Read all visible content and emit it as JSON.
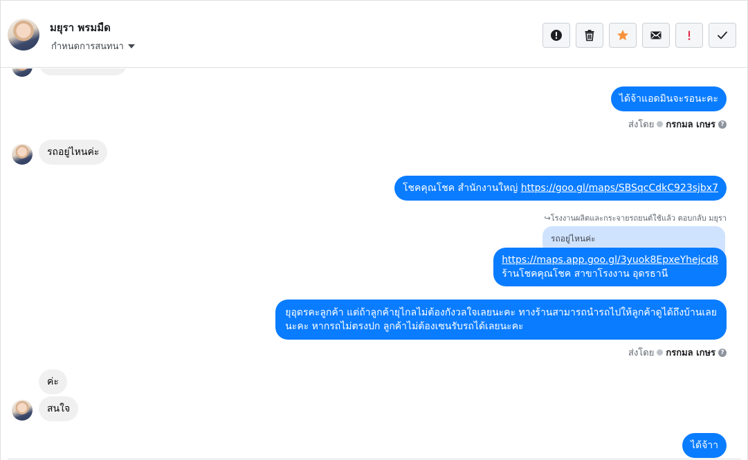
{
  "contact": {
    "name": "มยุรา พรมมืด",
    "assign_label": "กำหนดการสนทนา"
  },
  "toolbar": {
    "buttons": [
      {
        "icon": "spam-icon",
        "color": "#1c1e21"
      },
      {
        "icon": "trash-icon",
        "color": "#1c1e21"
      },
      {
        "icon": "star-icon",
        "color": "#f7923a"
      },
      {
        "icon": "mail-icon",
        "color": "#1c1e21"
      },
      {
        "icon": "important-icon",
        "color": "#e41e3f"
      },
      {
        "icon": "check-icon",
        "color": "#1c1e21"
      }
    ]
  },
  "messages": {
    "m1": "ได้จ้าแอดมินจะรอนะคะ",
    "m2": "รถอยู่ไหนค่ะ",
    "m3_text": "โชคคุณโชค สำนักงานใหญ่ ",
    "m3_link": "https://goo.gl/maps/SBSqcCdkC923sjbx7",
    "reply_hint": "โรงงานผลิตและกระจายรถยนต์ใช้แล้ว ตอบกลับ มยุรา",
    "reply_quote": "รถอยู่ไหนค่ะ",
    "m4_link": "https://maps.app.goo.gl/3yuok8EpxeYhejcd8",
    "m4_text": "ร้านโชคคุณโชค สาขาโรงงาน อุดรธานี",
    "m5_line1": "ยุอุดรคะลูกค้า แต่ถ้าลูกค้ายุไกลไม่ต้องกังวลใจเลยนะคะ ทางร้านสามารถนำรถไปให้ลูกค้าดูได้ถึงบ้านเลย",
    "m5_line2": "นะคะ หากรถไม่ตรงปก ลูกค้าไม่ต้องเซนรับรถได้เลยนะคะ",
    "m6": "ค่ะ",
    "m7": "สนใจ",
    "m8": "ได้จ้าา"
  },
  "sent_by": {
    "prefix": "ส่งโดย",
    "name": "กรกมล เกษร",
    "help": "?"
  },
  "colors": {
    "outgoing_bubble": "#0a7cff",
    "incoming_bubble": "#f0f0f0",
    "reply_quote_bg": "#cfe3ff"
  }
}
